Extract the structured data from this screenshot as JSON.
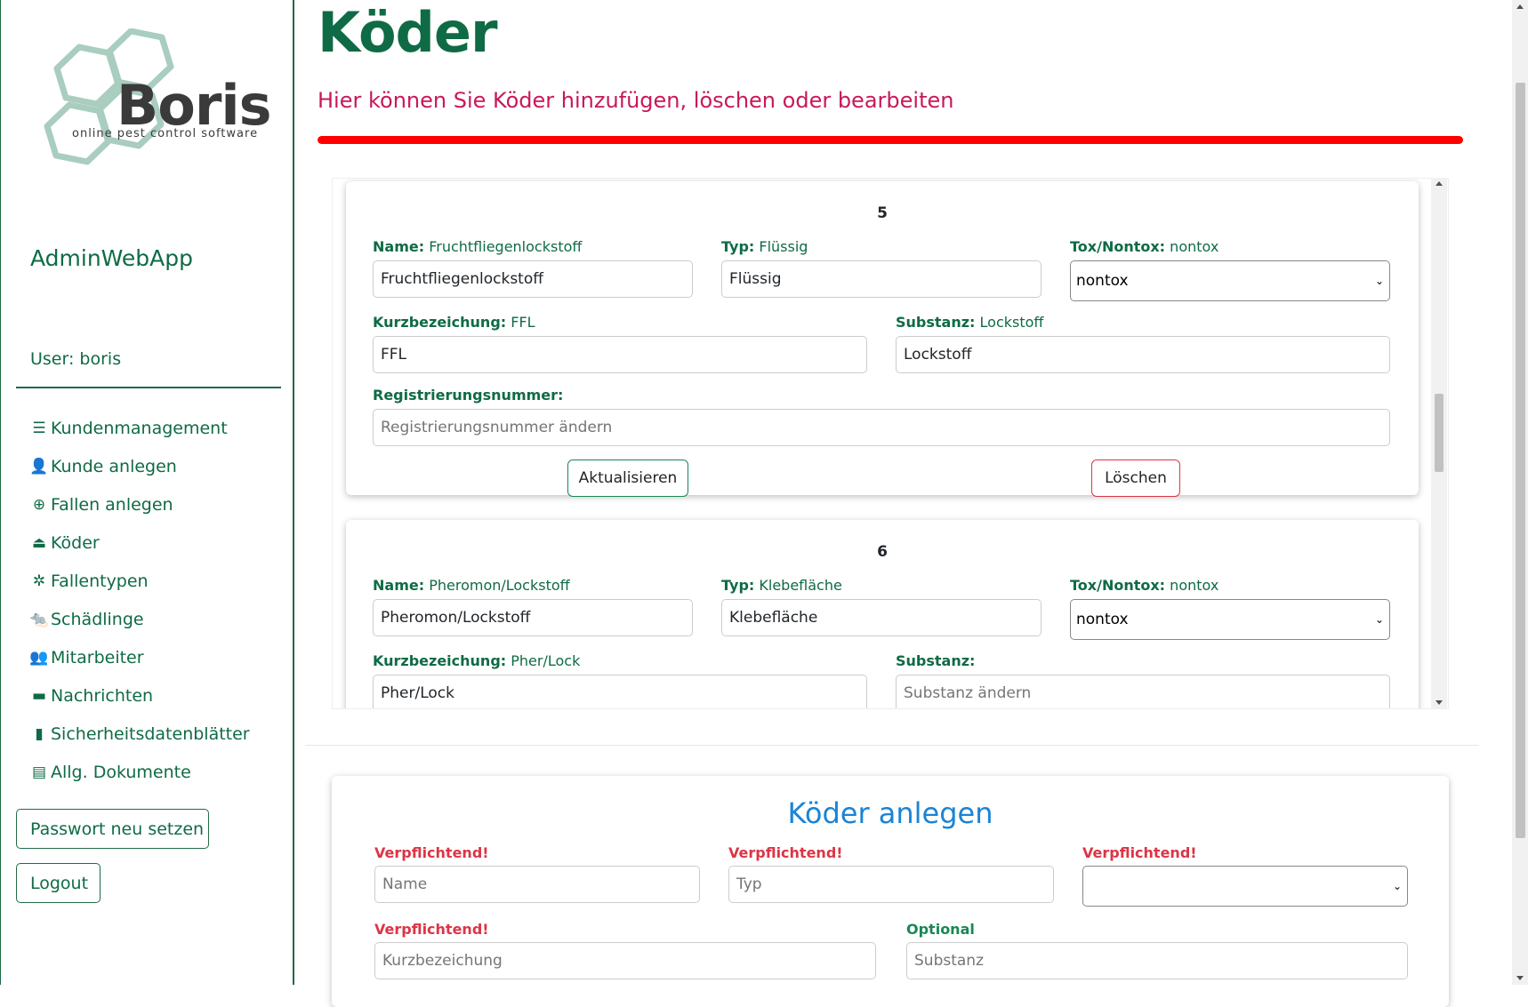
{
  "sidebar": {
    "logo_text": "Boris",
    "logo_tagline": "online pest control software",
    "app_name": "AdminWebApp",
    "user_label": "User: boris",
    "nav": [
      {
        "label": "Kundenmanagement",
        "icon": "list-check-icon"
      },
      {
        "label": "Kunde anlegen",
        "icon": "user-plus-icon"
      },
      {
        "label": "Fallen anlegen",
        "icon": "plus-circle-icon"
      },
      {
        "label": "Köder",
        "icon": "bait-icon"
      },
      {
        "label": "Fallentypen",
        "icon": "bug-slash-icon"
      },
      {
        "label": "Schädlinge",
        "icon": "rat-icon"
      },
      {
        "label": "Mitarbeiter",
        "icon": "people-group-icon"
      },
      {
        "label": "Nachrichten",
        "icon": "message-icon"
      },
      {
        "label": "Sicherheitsdatenblätter",
        "icon": "file-icon"
      },
      {
        "label": "Allg. Dokumente",
        "icon": "file-lines-icon"
      }
    ],
    "password_button": "Passwort neu setzen",
    "logout_button": "Logout"
  },
  "main": {
    "title": "Köder",
    "subtitle": "Hier können Sie Köder hinzufügen, löschen oder bearbeiten",
    "bait_cards": [
      {
        "number": "5",
        "name_label": "Name:",
        "name_value": "Fruchtfliegenlockstoff",
        "typ_label": "Typ:",
        "typ_value": "Flüssig",
        "tox_label": "Tox/Nontox:",
        "tox_value": "nontox",
        "kurz_label": "Kurzbezeichung:",
        "kurz_value": "FFL",
        "substanz_label": "Substanz:",
        "substanz_value": "Lockstoff",
        "reg_label": "Registrierungsnummer:",
        "reg_placeholder": "Registrierungsnummer ändern",
        "update_button": "Aktualisieren",
        "delete_button": "Löschen"
      },
      {
        "number": "6",
        "name_label": "Name:",
        "name_value": "Pheromon/Lockstoff",
        "typ_label": "Typ:",
        "typ_value": "Klebefläche",
        "tox_label": "Tox/Nontox:",
        "tox_value": "nontox",
        "kurz_label": "Kurzbezeichung:",
        "kurz_value": "Pher/Lock",
        "substanz_label": "Substanz:",
        "substanz_placeholder": "Substanz ändern"
      }
    ],
    "create": {
      "title": "Köder anlegen",
      "required_label": "Verpflichtend!",
      "optional_label": "Optional",
      "name_placeholder": "Name",
      "typ_placeholder": "Typ",
      "kurz_placeholder": "Kurzbezeichung",
      "substanz_placeholder": "Substanz"
    }
  },
  "colors": {
    "brand_green": "#0f6b45",
    "subtitle_pink": "#c8185b",
    "bar_red": "#ff0000",
    "create_title_blue": "#1a84d6",
    "required_red": "#dc3545",
    "optional_green": "#198754"
  }
}
